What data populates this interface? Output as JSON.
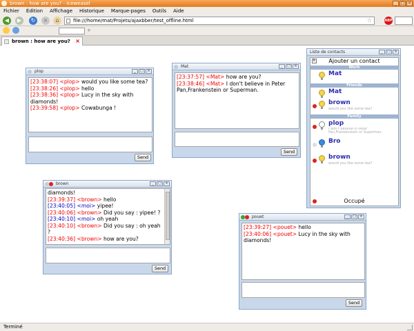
{
  "window": {
    "title": "brown : how are you? - Iceweasel"
  },
  "menu": {
    "items": [
      "Fichier",
      "Édition",
      "Affichage",
      "Historique",
      "Marque-pages",
      "Outils",
      "Aide"
    ]
  },
  "nav": {
    "url": "file:///home/mat/Projets/ajaxbber/test_offline.html"
  },
  "tab": {
    "label": "brown : how are you?"
  },
  "status": {
    "text": "Terminé"
  },
  "chats": {
    "plop": {
      "title": "plop",
      "send_label": "Send",
      "messages": [
        {
          "time": "[23:38:07]",
          "name": "<plop>",
          "text": "would you like some tea?"
        },
        {
          "time": "[23:38:26]",
          "name": "<plop>",
          "text": "hello"
        },
        {
          "time": "[23:38:36]",
          "name": "<plop>",
          "text": "Lucy in the sky with diamonds!"
        },
        {
          "time": "[23:39:58]",
          "name": "<plop>",
          "text": "Cowabunga !"
        }
      ]
    },
    "mat": {
      "title": "Mat",
      "send_label": "Send",
      "messages": [
        {
          "time": "[23:37:57]",
          "name": "<Mat>",
          "text": "how are you?"
        },
        {
          "time": "[23:38:46]",
          "name": "<Mat>",
          "text": "I don't believe in Peter Pan,Frankenstein or Superman."
        }
      ]
    },
    "brown": {
      "title": "brown",
      "send_label": "Send",
      "leading_text": "diamonds!",
      "messages": [
        {
          "time": "[23:39:37]",
          "name": "<brown>",
          "text": "hello",
          "self": false
        },
        {
          "time": "[23:40:05]",
          "name": "<moi>",
          "text": "yipee!",
          "self": true
        },
        {
          "time": "[23:40:06]",
          "name": "<brown>",
          "text": "Did you say : yipee! ?",
          "self": false
        },
        {
          "time": "[23:40:10]",
          "name": "<moi>",
          "text": "oh yeah",
          "self": true
        },
        {
          "time": "[23:40:10]",
          "name": "<brown>",
          "text": "Did you say : oh yeah ?",
          "self": false
        },
        {
          "time": "[23:40:36]",
          "name": "<brown>",
          "text": "how are you?",
          "self": false
        }
      ]
    },
    "pouet": {
      "title": "pouet",
      "send_label": "Send",
      "messages": [
        {
          "time": "[23:39:27]",
          "name": "<pouet>",
          "text": "hello"
        },
        {
          "time": "[23:40:06]",
          "name": "<pouet>",
          "text": "Lucy in the sky with diamonds!"
        }
      ]
    }
  },
  "contacts": {
    "title": "Liste de contacts",
    "add_label": "Ajouter un contact",
    "groups": {
      "work": "Work",
      "friends": "Friends",
      "family": "Family"
    },
    "items": [
      {
        "name": "Mat",
        "status": ""
      },
      {
        "name": "Mat",
        "status": ""
      },
      {
        "name": "brown",
        "status": "would you like some tea?"
      },
      {
        "name": "plop",
        "status": "I don't believe in Peter Pan,Frankenstein or Superman."
      },
      {
        "name": "Bro",
        "status": ""
      },
      {
        "name": "brown",
        "status": "would you like some tea?"
      }
    ],
    "my_status": "Occupé"
  },
  "colors": {
    "accent_window": "#c8d8ea",
    "time_other": "#e00000",
    "time_self": "#0000c0",
    "titlebar": "#e27a1c"
  }
}
